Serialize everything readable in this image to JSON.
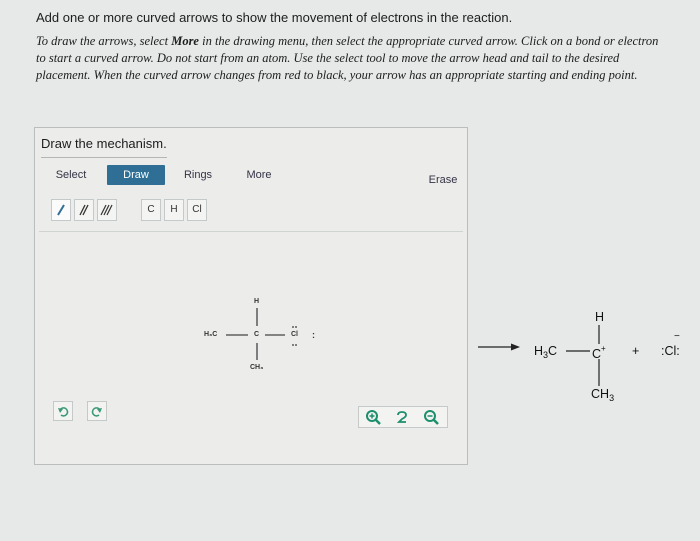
{
  "instructions": {
    "question": "Add one or more curved arrows to show the movement of electrons in the reaction.",
    "line1_a": "To draw the arrows, select ",
    "line1_more": "More",
    "line1_b": " in the drawing menu, then select the appropriate curved arrow. Click on a bond or electron",
    "line2": "to start a curved arrow. Do not start from an atom. Use the select tool to move the arrow head and tail to the desired",
    "line3": "placement. When the curved arrow changes from red to black, your arrow has an appropriate starting and ending point."
  },
  "panel": {
    "title": "Draw the mechanism.",
    "tabs": [
      "Select",
      "Draw",
      "Rings",
      "More",
      "Erase"
    ],
    "active_tab": "Draw",
    "bond_tools": [
      "single-bond",
      "double-bond",
      "triple-bond"
    ],
    "atom_buttons": [
      "C",
      "H",
      "Cl"
    ]
  },
  "reactant": {
    "top": "H",
    "left": "H₃C",
    "center": "C",
    "right": "Cl",
    "lone_pairs": ":",
    "bottom": "CH₃"
  },
  "product": {
    "top": "H",
    "left_main": "H",
    "left_sub": "3",
    "left_tail": "C",
    "center": "C",
    "charge": "+",
    "bottom_main": "CH",
    "bottom_sub": "3",
    "plus": "+",
    "anion": ":Cl:",
    "anion_charge": "−"
  },
  "colors": {
    "accent": "#2f6f96",
    "zoom_icon": "#1c8f6c",
    "undo_icon": "#3a9a78"
  }
}
